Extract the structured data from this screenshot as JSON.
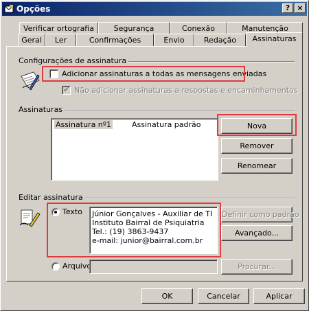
{
  "window": {
    "title": "Opções",
    "help_label": "?",
    "close_label": "×"
  },
  "tabs": {
    "row_back": [
      {
        "label": "Verificar ortografia"
      },
      {
        "label": "Segurança"
      },
      {
        "label": "Conexão"
      },
      {
        "label": "Manutenção"
      }
    ],
    "row_front": [
      {
        "label": "Geral"
      },
      {
        "label": "Ler"
      },
      {
        "label": "Confirmações"
      },
      {
        "label": "Envio"
      },
      {
        "label": "Redação"
      },
      {
        "label": "Assinaturas",
        "selected": true
      }
    ]
  },
  "settings_group": {
    "title": "Configurações de assinatura",
    "add_to_all": {
      "label": "Adicionar assinaturas a todas as mensagens enviadas",
      "checked": false
    },
    "no_replies": {
      "label": "Não adicionar assinaturas a respostas e encaminhamentos",
      "checked": true,
      "enabled": false
    }
  },
  "signatures_group": {
    "title": "Assinaturas",
    "list": [
      {
        "name": "Assinatura nº1",
        "note": "Assinatura padrão",
        "selected": true
      }
    ],
    "buttons": {
      "new": "Nova",
      "remove": "Remover",
      "rename": "Renomear"
    }
  },
  "edit_group": {
    "title": "Editar assinatura",
    "text_option": {
      "label": "Texto",
      "selected": true
    },
    "file_option": {
      "label": "Arquivo",
      "selected": false
    },
    "text_lines": [
      "Júnior Gonçalves - Auxiliar de TI",
      "Instituto Bairral de Psiquiatria",
      "Tel.: (19) 3863-9437",
      "e-mail: junior@bairral.com.br"
    ],
    "file_path": "",
    "buttons": {
      "set_default": "Definir como padrão",
      "advanced": "Avançado...",
      "browse": "Procurar..."
    }
  },
  "footer": {
    "ok": "OK",
    "cancel": "Cancelar",
    "apply": "Aplicar"
  },
  "colors": {
    "titlebar_start": "#0a246a",
    "titlebar_end": "#3a6ea5",
    "highlight_box": "#e0393e",
    "face": "#d4d0c8"
  }
}
